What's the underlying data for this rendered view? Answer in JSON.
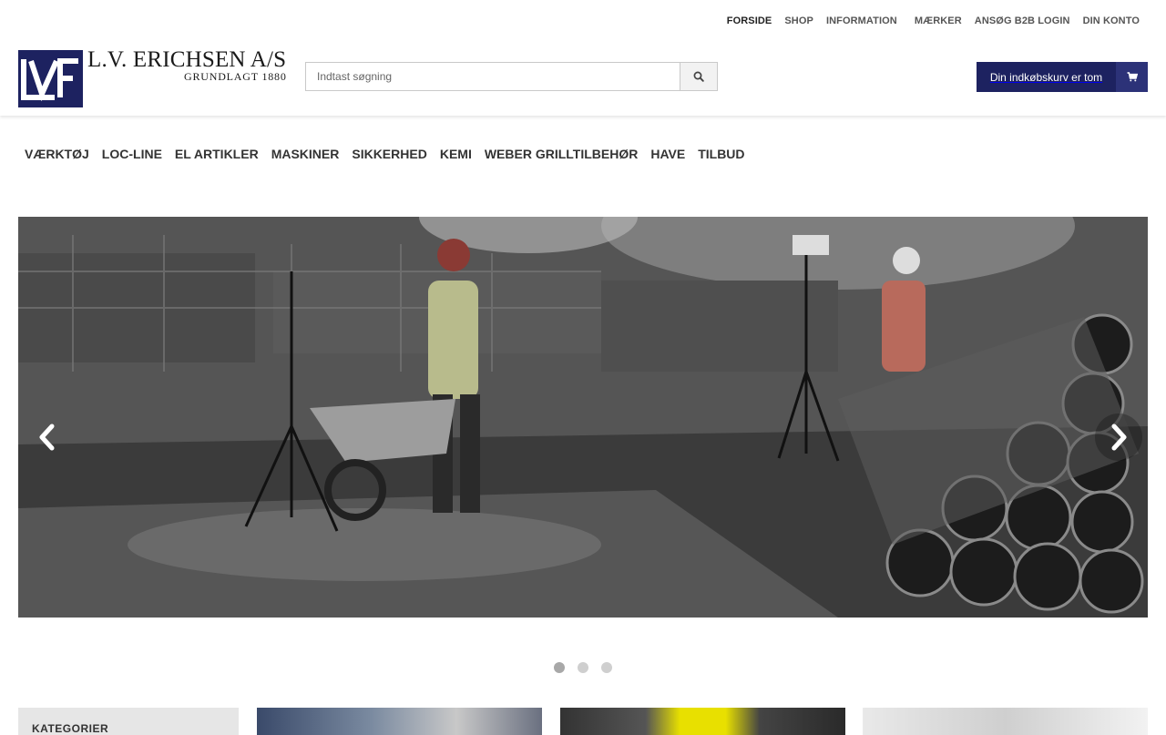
{
  "topnav": {
    "items": [
      "FORSIDE",
      "SHOP",
      "INFORMATION",
      "MÆRKER",
      "ANSØG B2B LOGIN",
      "DIN KONTO"
    ]
  },
  "logo": {
    "title": "L.V. ERICHSEN A/S",
    "subtitle": "GRUNDLAGT 1880"
  },
  "search": {
    "placeholder": "Indtast søgning",
    "icon": "search-icon"
  },
  "cart": {
    "label": "Din indkøbskurv er tom",
    "icon": "cart-icon"
  },
  "mainnav": {
    "items": [
      "VÆRKTØJ",
      "LOC-LINE",
      "EL ARTIKLER",
      "MASKINER",
      "SIKKERHED",
      "KEMI",
      "WEBER GRILLTILBEHØR",
      "HAVE",
      "TILBUD"
    ]
  },
  "slider": {
    "slide_count": 3,
    "active_slide": 1,
    "prev_icon": "chevron-left-icon",
    "next_icon": "chevron-right-icon"
  },
  "sidebar": {
    "categories_title": "KATEGORIER"
  },
  "colors": {
    "brand": "#1d2260",
    "brand_light": "#2c3278"
  }
}
